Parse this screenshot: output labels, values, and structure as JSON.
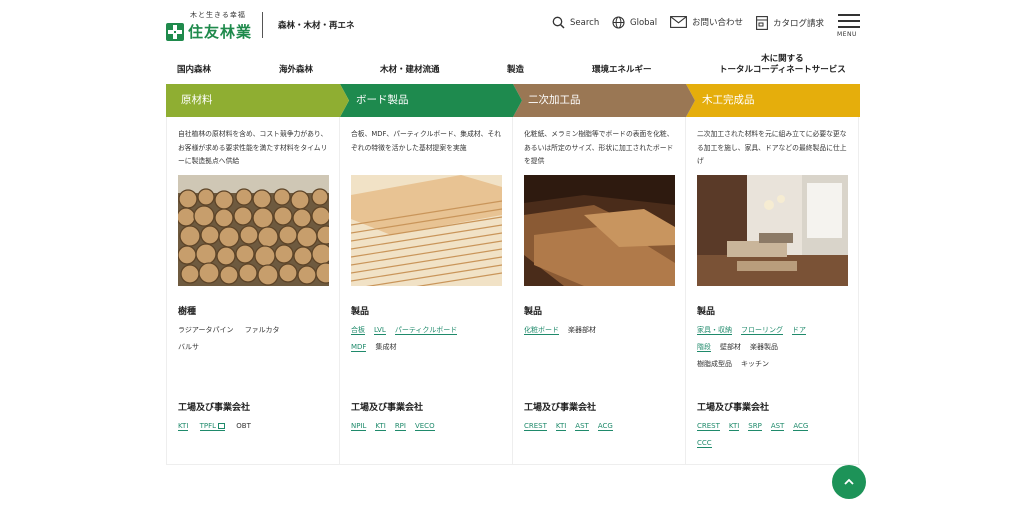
{
  "header": {
    "logo_tagline": "木と生きる幸福",
    "logo_name": "住友林業",
    "tagline": "森林・木材・再エネ",
    "search_label": "Search",
    "global_label": "Global",
    "contact_label": "お問い合わせ",
    "catalog_label": "カタログ請求",
    "menu_label": "MENU"
  },
  "categories": [
    "国内森林",
    "海外森林",
    "木材・建材流通",
    "製造",
    "環境エネルギー",
    "木に関する\nトータルコーディネートサービス"
  ],
  "stages": [
    {
      "label": "原材料",
      "color": "#8fae32"
    },
    {
      "label": "ボード製品",
      "color": "#1e8a4e"
    },
    {
      "label": "二次加工品",
      "color": "#9a7754"
    },
    {
      "label": "木工完成品",
      "color": "#e5ae0c"
    }
  ],
  "columns": [
    {
      "desc": "自社植林の原材料を含め、コスト競争力があり、お客様が求める要求性能を満たす材料をタイムリーに製造拠点へ供給",
      "heading": "樹種",
      "items": [
        {
          "text": "ラジアータパイン",
          "link": false
        },
        {
          "text": "ファルカタ",
          "link": false
        },
        {
          "text": "バルサ",
          "link": false
        }
      ],
      "heading2": "工場及び事業会社",
      "items2": [
        {
          "text": "KTI",
          "link": true
        },
        {
          "text": "TPFL",
          "link": true,
          "ext": true
        },
        {
          "text": "OBT",
          "link": false
        }
      ]
    },
    {
      "desc": "合板、MDF、パーティクルボード、集成材、それぞれの特徴を活かした基材提案を実施",
      "heading": "製品",
      "items": [
        {
          "text": "合板",
          "link": true
        },
        {
          "text": "LVL",
          "link": true
        },
        {
          "text": "パーティクルボード",
          "link": true
        },
        {
          "text": "MDF",
          "link": true
        },
        {
          "text": "集成材",
          "link": false
        }
      ],
      "heading2": "工場及び事業会社",
      "items2": [
        {
          "text": "NPIL",
          "link": true
        },
        {
          "text": "KTI",
          "link": true
        },
        {
          "text": "RPI",
          "link": true
        },
        {
          "text": "VECO",
          "link": true
        }
      ]
    },
    {
      "desc": "化粧紙、メラミン樹脂等でボードの表面を化粧、あるいは所定のサイズ、形状に加工されたボードを提供",
      "heading": "製品",
      "items": [
        {
          "text": "化粧ボード",
          "link": true
        },
        {
          "text": "楽器部材",
          "link": false
        }
      ],
      "heading2": "工場及び事業会社",
      "items2": [
        {
          "text": "CREST",
          "link": true
        },
        {
          "text": "KTI",
          "link": true
        },
        {
          "text": "AST",
          "link": true
        },
        {
          "text": "ACG",
          "link": true
        }
      ]
    },
    {
      "desc": "二次加工された材料を元に組み立てに必要な更なる加工を施し、家具、ドアなどの最終製品に仕上げ",
      "heading": "製品",
      "items": [
        {
          "text": "家具・収納",
          "link": true
        },
        {
          "text": "フローリング",
          "link": true
        },
        {
          "text": "ドア",
          "link": true
        },
        {
          "text": "階段",
          "link": true
        },
        {
          "text": "壁部材",
          "link": false
        },
        {
          "text": "楽器製品",
          "link": false
        },
        {
          "text": "樹脂成型品",
          "link": false
        },
        {
          "text": "キッチン",
          "link": false
        }
      ],
      "heading2": "工場及び事業会社",
      "items2": [
        {
          "text": "CREST",
          "link": true
        },
        {
          "text": "KTI",
          "link": true
        },
        {
          "text": "SRP",
          "link": true
        },
        {
          "text": "AST",
          "link": true
        },
        {
          "text": "ACG",
          "link": true
        },
        {
          "text": "CCC",
          "link": true
        }
      ]
    }
  ]
}
